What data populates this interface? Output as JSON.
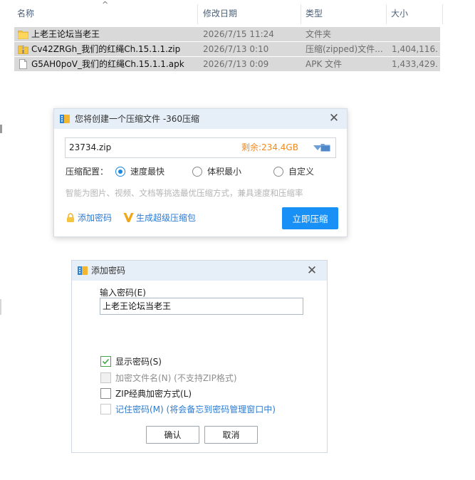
{
  "explorer": {
    "headers": {
      "name": "名称",
      "date": "修改日期",
      "type": "类型",
      "size": "大小"
    },
    "sort_glyph": "^",
    "files": [
      {
        "icon": "folder-icon",
        "name": "上老王论坛当老王",
        "date": "2026/7/15 11:24",
        "type": "文件夹",
        "size": ""
      },
      {
        "icon": "zip-file-icon",
        "name": "Cv42ZRGh_我们的红绳Ch.15.1.1.zip",
        "date": "2026/7/13 0:10",
        "type": "压缩(zipped)文件...",
        "size": "1,404,116..."
      },
      {
        "icon": "apk-file-icon",
        "name": "G5AH0poV_我们的红绳Ch.15.1.1.apk",
        "date": "2026/7/13 0:09",
        "type": "APK 文件",
        "size": "1,433,429..."
      }
    ]
  },
  "compress_dialog": {
    "title": "您将创建一个压缩文件 -360压缩",
    "filename": "23734.zip",
    "free_space": "剩余:234.4GB",
    "config_label": "压缩配置：",
    "options": [
      {
        "label": "速度最快",
        "selected": true
      },
      {
        "label": "体积最小",
        "selected": false
      },
      {
        "label": "自定义",
        "selected": false
      }
    ],
    "hint": "智能为图片、视频、文档等挑选最优压缩方式，兼具速度和压缩率",
    "add_password_link": "添加密码",
    "super_compress_link": "生成超级压缩包",
    "compress_button": "立即压缩"
  },
  "password_dialog": {
    "title": "添加密码",
    "input_label": "输入密码(E)",
    "password_value": "上老王论坛当老王",
    "checkboxes": [
      {
        "label": "显示密码(S)",
        "checked": true,
        "disabled": false
      },
      {
        "label": "加密文件名(N) (不支持ZIP格式)",
        "checked": false,
        "disabled": true
      },
      {
        "label": "ZIP经典加密方式(L)",
        "checked": false,
        "disabled": false
      },
      {
        "label": "记住密码(M) (将会备忘到密码管理窗口中)",
        "checked": false,
        "disabled": false
      }
    ],
    "ok_button": "确认",
    "cancel_button": "取消"
  },
  "colors": {
    "accent_blue": "#1990f5",
    "link_blue": "#2b7bd3",
    "free_space_orange": "#f08a1c",
    "titlebar_bg": "#e6eef7",
    "selected_row_bg": "#d9d9d9"
  }
}
